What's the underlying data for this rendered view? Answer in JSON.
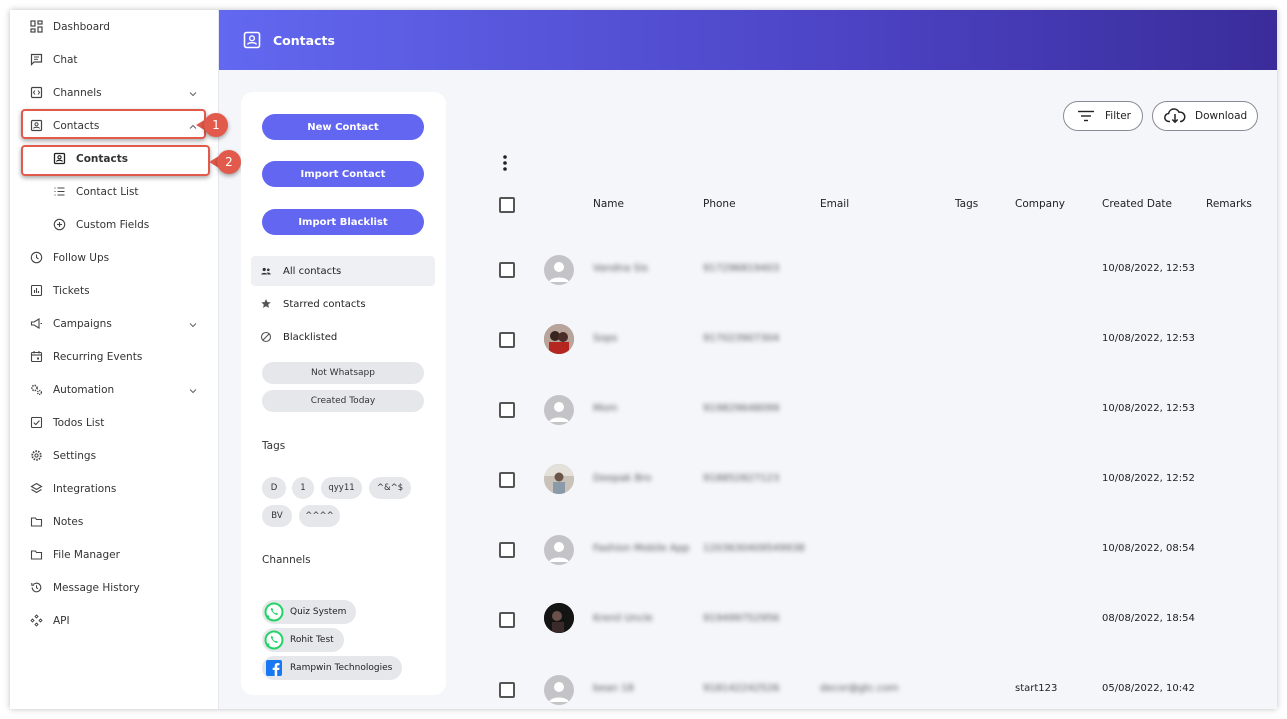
{
  "sidebar": {
    "items": [
      {
        "label": "Dashboard",
        "icon": "dashboard-icon"
      },
      {
        "label": "Chat",
        "icon": "chat-icon"
      },
      {
        "label": "Channels",
        "icon": "channels-icon"
      },
      {
        "label": "Contacts",
        "icon": "contacts-icon"
      },
      {
        "label": "Contacts",
        "icon": "contacts-icon"
      },
      {
        "label": "Contact List",
        "icon": "list-icon"
      },
      {
        "label": "Custom Fields",
        "icon": "plus-circle-icon"
      },
      {
        "label": "Follow Ups",
        "icon": "clock-icon"
      },
      {
        "label": "Tickets",
        "icon": "tickets-icon"
      },
      {
        "label": "Campaigns",
        "icon": "megaphone-icon"
      },
      {
        "label": "Recurring Events",
        "icon": "calendar-icon"
      },
      {
        "label": "Automation",
        "icon": "gears-icon"
      },
      {
        "label": "Todos List",
        "icon": "checkbox-icon"
      },
      {
        "label": "Settings",
        "icon": "gear-icon"
      },
      {
        "label": "Integrations",
        "icon": "layers-icon"
      },
      {
        "label": "Notes",
        "icon": "folder-icon"
      },
      {
        "label": "File Manager",
        "icon": "folder-icon"
      },
      {
        "label": "Message History",
        "icon": "history-icon"
      },
      {
        "label": "API",
        "icon": "api-icon"
      }
    ],
    "callouts": [
      "1",
      "2"
    ]
  },
  "header": {
    "title": "Contacts"
  },
  "panel": {
    "buttons": [
      "New Contact",
      "Import Contact",
      "Import Blacklist"
    ],
    "filters": [
      "All contacts",
      "Starred contacts",
      "Blacklisted"
    ],
    "quick_filters": [
      "Not Whatsapp",
      "Created Today"
    ],
    "tags_label": "Tags",
    "tags": [
      "D",
      "1",
      "qyy11",
      "^&^$",
      "BV",
      "^^^^"
    ],
    "channels_label": "Channels",
    "channels": [
      {
        "name": "Quiz System",
        "icon": "whatsapp-icon"
      },
      {
        "name": "Rohit Test",
        "icon": "whatsapp-icon"
      },
      {
        "name": "Rampwin Technologies",
        "icon": "facebook-icon"
      }
    ]
  },
  "toolbar": {
    "filter_label": "Filter",
    "download_label": "Download"
  },
  "table": {
    "columns": [
      "Name",
      "Phone",
      "Email",
      "Tags",
      "Company",
      "Created Date",
      "Remarks"
    ],
    "rows": [
      {
        "name": "Vandna Sis",
        "phone": "917296819403",
        "email": "",
        "company": "",
        "created": "10/08/2022, 12:53"
      },
      {
        "name": "Sops",
        "phone": "917023907304",
        "email": "",
        "company": "",
        "created": "10/08/2022, 12:53"
      },
      {
        "name": "Mom",
        "phone": "919829648099",
        "email": "",
        "company": "",
        "created": "10/08/2022, 12:53"
      },
      {
        "name": "Deepak Bro",
        "phone": "918852827123",
        "email": "",
        "company": "",
        "created": "10/08/2022, 12:52"
      },
      {
        "name": "Fashion Mobile App",
        "phone": "1203630409549938",
        "email": "",
        "company": "",
        "created": "10/08/2022, 08:54"
      },
      {
        "name": "Krenil Uncle",
        "phone": "919499752956",
        "email": "",
        "company": "",
        "created": "08/08/2022, 18:54"
      },
      {
        "name": "bean 18",
        "phone": "918142242526",
        "email": "decor@gtc.com",
        "company": "start123",
        "created": "05/08/2022, 10:42"
      }
    ]
  }
}
